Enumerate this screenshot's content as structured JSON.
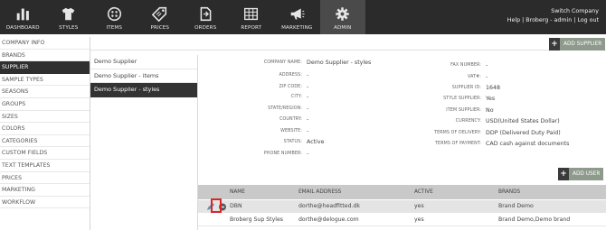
{
  "nav": {
    "items": [
      {
        "label": "DASHBOARD",
        "icon": "dashboard-bars-icon"
      },
      {
        "label": "STYLES",
        "icon": "shirt-icon"
      },
      {
        "label": "ITEMS",
        "icon": "buttons-icon"
      },
      {
        "label": "PRICES",
        "icon": "price-tag-icon"
      },
      {
        "label": "ORDERS",
        "icon": "order-document-icon"
      },
      {
        "label": "REPORT",
        "icon": "report-grid-icon"
      },
      {
        "label": "MARKETING",
        "icon": "megaphone-icon"
      },
      {
        "label": "ADMIN",
        "icon": "gear-icon"
      }
    ],
    "active": "ADMIN"
  },
  "company": {
    "name": "Switch Company",
    "help": "Help",
    "sep1": "|",
    "user": "Broberg - admin",
    "sep2": "|",
    "logout": "Log out"
  },
  "left_menu": {
    "items": [
      "COMPANY INFO",
      "BRANDS",
      "SUPPLIER",
      "SAMPLE TYPES",
      "SEASONS",
      "GROUPS",
      "SIZES",
      "COLORS",
      "CATEGORIES",
      "CUSTOM FIELDS",
      "TEXT TEMPLATES",
      "PRICES",
      "MARKETING",
      "WORKFLOW"
    ],
    "active": "SUPPLIER"
  },
  "suppliers": {
    "items": [
      "Demo Supplier",
      "Demo Supplier - items",
      "Demo Supplier - styles"
    ],
    "active": "Demo Supplier - styles"
  },
  "add_supplier_label": "ADD SUPPLIER",
  "add_user_label": "ADD USER",
  "detail_left": [
    {
      "label": "COMPANY NAME:",
      "value": "Demo Supplier - styles"
    },
    {
      "label": "ADDRESS:",
      "value": "-"
    },
    {
      "label": "ZIP CODE:",
      "value": "-"
    },
    {
      "label": "CITY:",
      "value": "-"
    },
    {
      "label": "STATE/REGION:",
      "value": "-"
    },
    {
      "label": "COUNTRY:",
      "value": "-"
    },
    {
      "label": "WEBSITE:",
      "value": "-"
    },
    {
      "label": "STATUS:",
      "value": "Active"
    },
    {
      "label": "PHONE NUMBER:",
      "value": "-"
    }
  ],
  "detail_right": [
    {
      "label": "FAX NUMBER:",
      "value": "-"
    },
    {
      "label": "VAT#:",
      "value": "-"
    },
    {
      "label": "SUPPLIER ID:",
      "value": "1648"
    },
    {
      "label": "STYLE SUPPLIER:",
      "value": "Yes"
    },
    {
      "label": "ITEM SUPPLIER:",
      "value": "No"
    },
    {
      "label": "CURRENCY:",
      "value": "USD(United States Dollar)"
    },
    {
      "label": "TERMS OF DELIVERY:",
      "value": "DDP (Delivered Duty Paid)"
    },
    {
      "label": "TERMS OF PAYMENT:",
      "value": "CAD cash against documents"
    }
  ],
  "users_table": {
    "columns": [
      "NAME",
      "EMAIL ADDRESS",
      "ACTIVE",
      "BRANDS"
    ],
    "rows": [
      {
        "name": "DBN",
        "email": "dorthe@headfitted.dk",
        "active": "yes",
        "brands": "Brand Demo"
      },
      {
        "name": "Broberg Sup Styles",
        "email": "dorthe@delogue.com",
        "active": "yes",
        "brands": "Brand Demo,Demo brand"
      }
    ]
  },
  "colors": {
    "topbar": "#2b2b2b",
    "active_dark": "#333333",
    "button_green": "#8e9a8b",
    "highlight_red": "#d9262b"
  }
}
